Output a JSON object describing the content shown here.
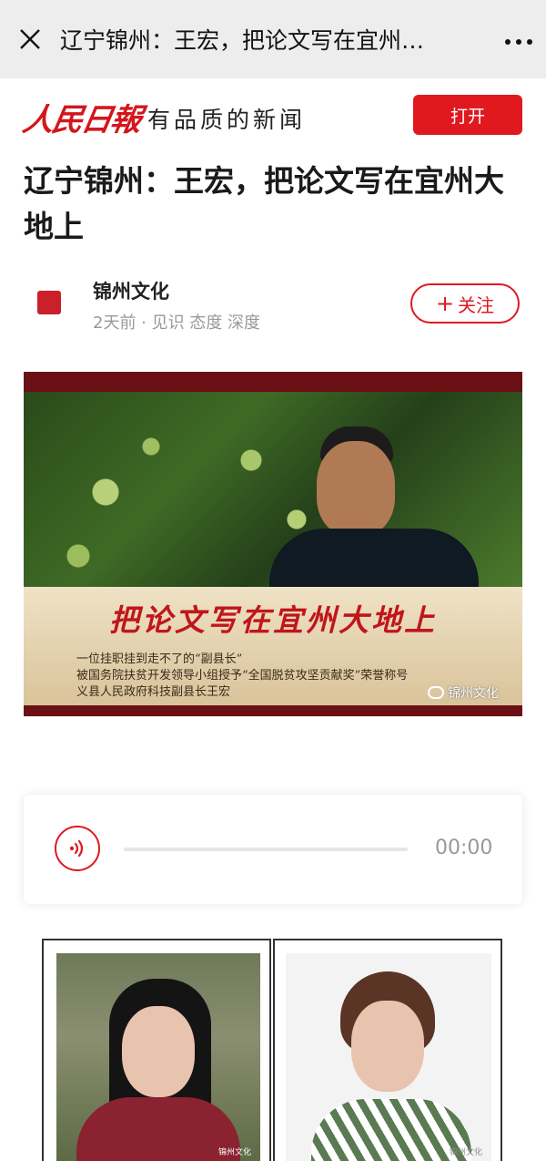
{
  "topbar": {
    "title": "辽宁锦州：王宏，把论文写在宜州…"
  },
  "banner": {
    "logo": "人民日報",
    "slogan": "有品质的新闻",
    "open_label": "打开"
  },
  "article": {
    "headline": "辽宁锦州：王宏，把论文写在宜州大地上"
  },
  "author": {
    "name": "锦州文化",
    "meta": "2天前 · 见识 态度 深度",
    "follow_plus": "+",
    "follow_label": "关注"
  },
  "hero_image": {
    "caption_title": "把论文写在宜州大地上",
    "line1": "一位挂职挂到走不了的“副县长”",
    "line2": "被国务院扶贫开发领导小组授予“全国脱贫攻坚贡献奖”荣誉称号",
    "line3": "义县人民政府科技副县长王宏",
    "watermark": "锦州文化"
  },
  "audio": {
    "time": "00:00",
    "progress": 0
  },
  "portraits": {
    "left_watermark": "锦州文化",
    "right_watermark": "锦州文化"
  },
  "colors": {
    "accent": "#e0191f"
  }
}
